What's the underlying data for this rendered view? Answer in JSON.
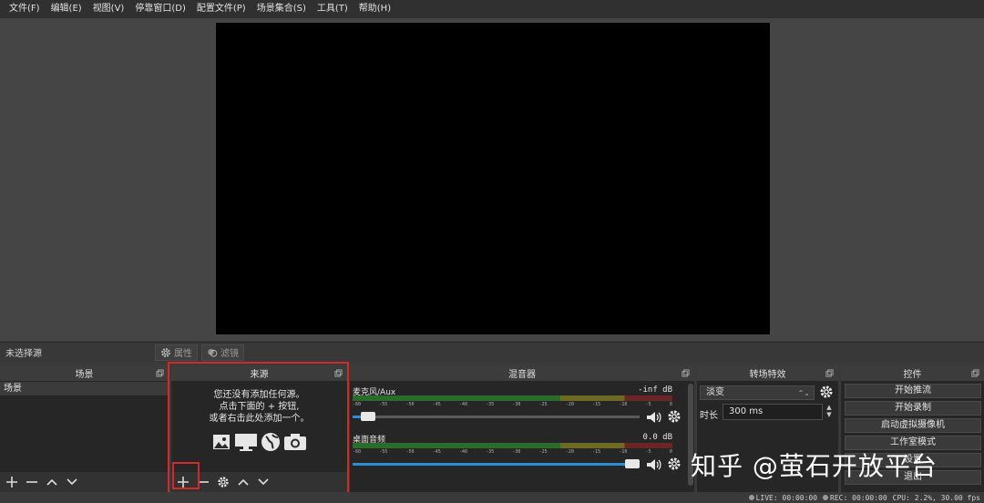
{
  "menu": [
    "文件(F)",
    "编辑(E)",
    "视图(V)",
    "停靠窗口(D)",
    "配置文件(P)",
    "场景集合(S)",
    "工具(T)",
    "帮助(H)"
  ],
  "context_bar": {
    "no_source": "未选择源",
    "properties": "属性",
    "filters": "滤镜"
  },
  "scenes": {
    "title": "场景",
    "items": [
      "场景"
    ]
  },
  "sources": {
    "title": "来源",
    "empty_line1": "您还没有添加任何源。",
    "empty_line2": "点击下面的 + 按钮,",
    "empty_line3": "或者右击此处添加一个。"
  },
  "mixer": {
    "title": "混音器",
    "ticks": [
      "-60",
      "-55",
      "-50",
      "-45",
      "-40",
      "-35",
      "-30",
      "-25",
      "-20",
      "-15",
      "-10",
      "-5",
      "0"
    ],
    "channels": [
      {
        "name": "麦克风/Aux",
        "db": "-inf dB",
        "volume": 0.03
      },
      {
        "name": "桌面音频",
        "db": "0.0 dB",
        "volume": 1.0
      }
    ]
  },
  "transitions": {
    "title": "转场特效",
    "selected": "淡变",
    "duration_label": "时长",
    "duration_value": "300 ms"
  },
  "controls": {
    "title": "控件",
    "buttons": [
      "开始推流",
      "开始录制",
      "启动虚拟摄像机",
      "工作室模式",
      "设置",
      "退出"
    ]
  },
  "status": {
    "live": "LIVE: 00:00:00",
    "rec": "REC: 00:00:00",
    "cpu": "CPU: 2.2%, 30.00 fps"
  },
  "watermark": "知乎 @萤石开放平台",
  "colors": {
    "highlight": "#d22a2a",
    "fader_blue": "#2c8fd6"
  }
}
